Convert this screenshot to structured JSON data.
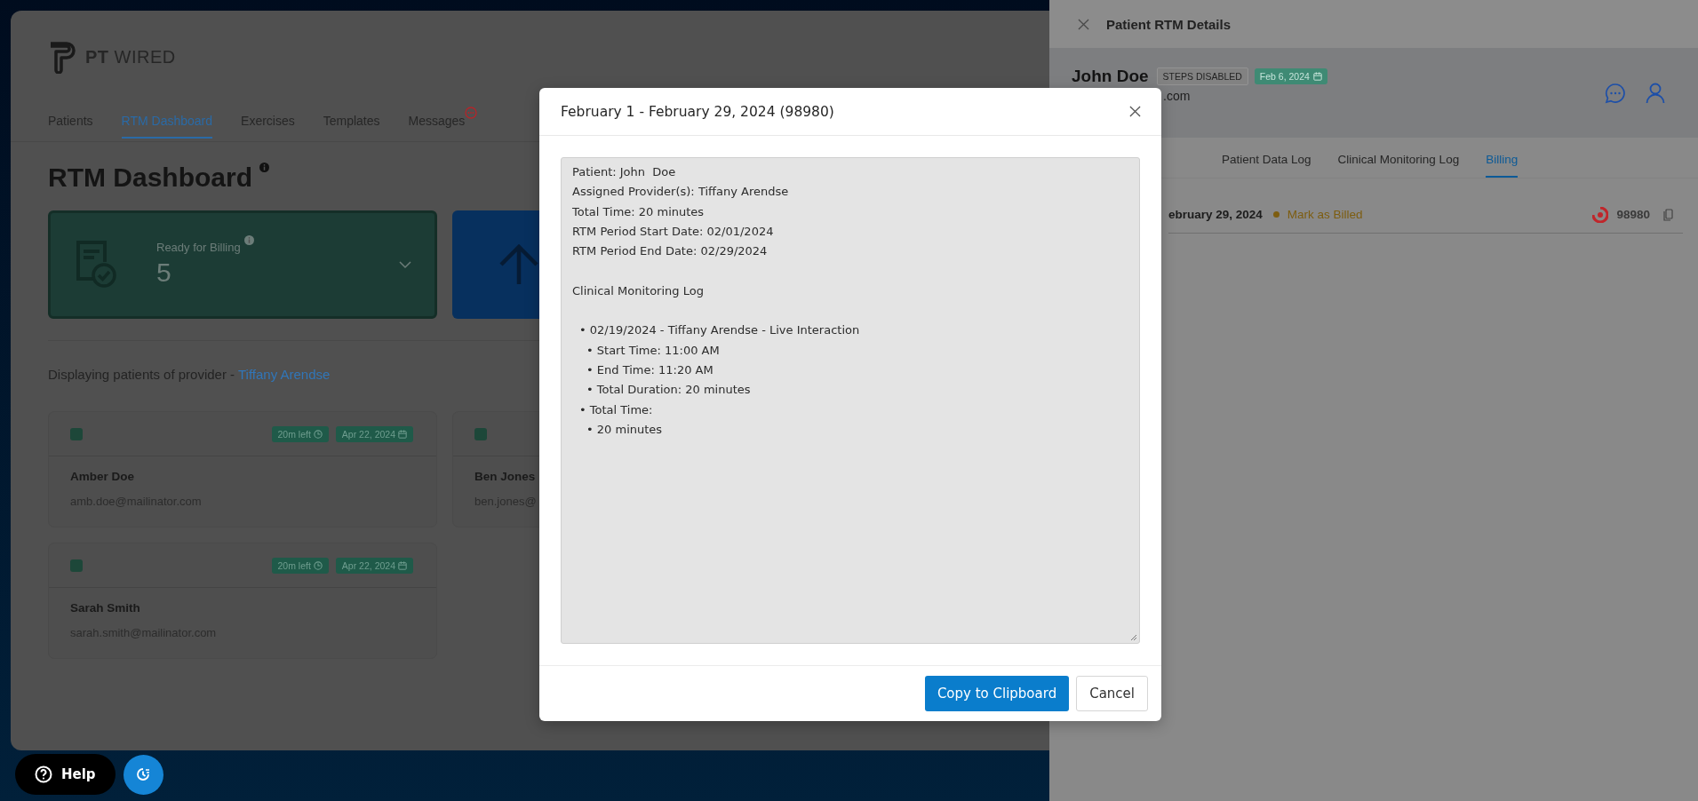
{
  "app": {
    "logo_text": {
      "bold": "PT",
      "light": "WIRED"
    },
    "nav": [
      {
        "label": "Patients",
        "selected": false,
        "badge": false
      },
      {
        "label": "RTM Dashboard",
        "selected": true,
        "badge": false
      },
      {
        "label": "Exercises",
        "selected": false,
        "badge": false
      },
      {
        "label": "Templates",
        "selected": false,
        "badge": false
      },
      {
        "label": "Messages",
        "selected": false,
        "badge": true
      }
    ],
    "page_title": "RTM Dashboard",
    "summary_cards": [
      {
        "kind": "billing",
        "label": "Ready for Billing",
        "value": "5"
      },
      {
        "kind": "upload"
      }
    ],
    "provider_line": {
      "text": "Displaying patients of provider - ",
      "provider": "Tiffany Arendse"
    },
    "patients": [
      {
        "checked": false,
        "name": "Amber Doe",
        "email": "amb.doe@mailinator.com",
        "time_left": "20m left",
        "date": "Apr 22, 2024"
      },
      {
        "checked": false,
        "name": "Ben Jones",
        "email": "ben.jones@"
      },
      {
        "checked": false,
        "name": "Sarah Smith",
        "email": "sarah.smith@mailinator.com",
        "time_left": "20m left",
        "date": "Apr 22, 2024"
      }
    ],
    "help_button": "Help"
  },
  "drawer": {
    "title": "Patient RTM Details",
    "patient_name": "John Doe",
    "steps_badge": "STEPS DISABLED",
    "date_badge": "Feb 6, 2024",
    "email": ".com",
    "tabs": [
      {
        "label": "Patient Data Log",
        "selected": false
      },
      {
        "label": "Clinical Monitoring Log",
        "selected": false
      },
      {
        "label": "Billing",
        "selected": true
      }
    ],
    "billing_row": {
      "period": "ebruary 29, 2024",
      "action": "Mark as Billed",
      "code": "98980"
    }
  },
  "modal": {
    "title": "February 1 - February 29, 2024 (98980)",
    "summary": {
      "header_lines": [
        "Patient: John  Doe",
        "Assigned Provider(s): Tiffany Arendse",
        "Total Time: 20 minutes",
        "RTM Period Start Date: 02/01/2024",
        "RTM Period End Date: 02/29/2024"
      ],
      "section_title": "Clinical Monitoring Log",
      "entries": [
        {
          "text": "• 02/19/2024 - Tiffany Arendse - Live Interaction",
          "children": [
            {
              "text": "• Start Time: 11:00 AM"
            },
            {
              "text": "• End Time: 11:20 AM"
            },
            {
              "text": "• Total Duration: 20 minutes"
            }
          ]
        },
        {
          "text": "• Total Time:",
          "children": [
            {
              "text": "• 20 minutes"
            }
          ]
        }
      ]
    },
    "buttons": [
      {
        "kind": "primary",
        "label": "Copy to Clipboard"
      },
      {
        "kind": "secondary",
        "label": "Cancel"
      }
    ]
  }
}
